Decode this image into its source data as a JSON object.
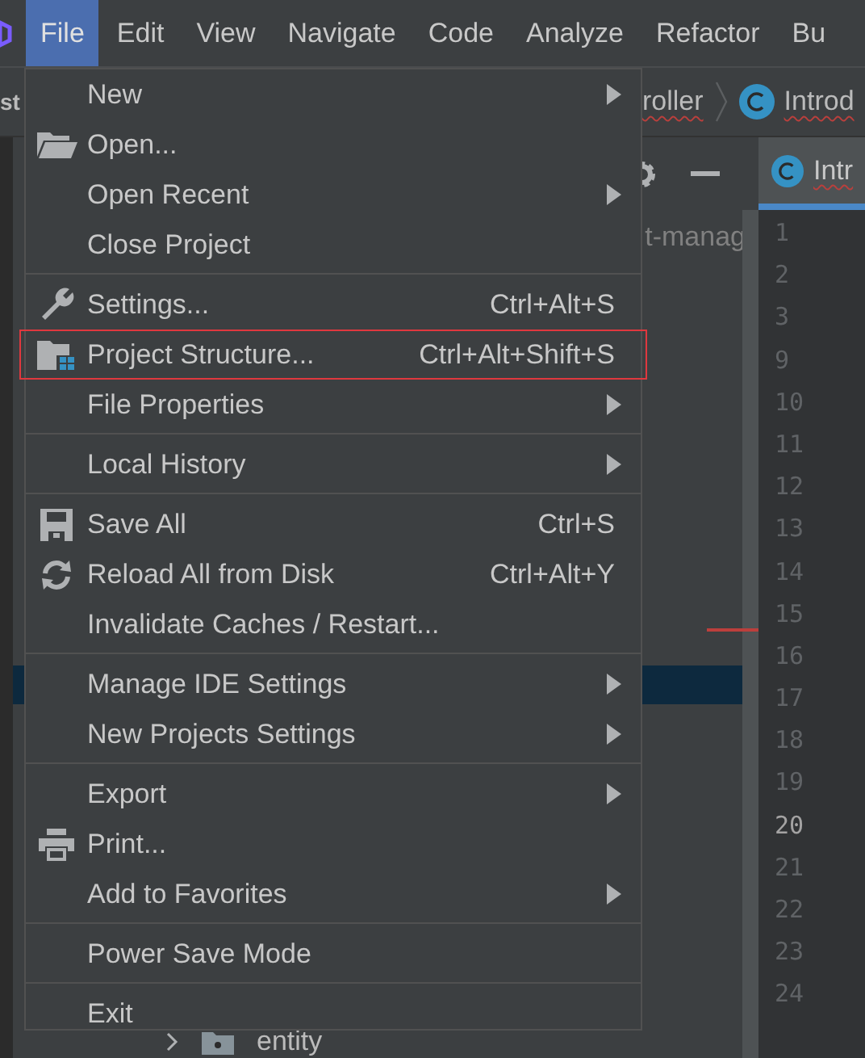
{
  "menu_bar": [
    {
      "label": "File",
      "selected": true
    },
    {
      "label": "Edit",
      "selected": false
    },
    {
      "label": "View",
      "selected": false
    },
    {
      "label": "Navigate",
      "selected": false
    },
    {
      "label": "Code",
      "selected": false
    },
    {
      "label": "Analyze",
      "selected": false
    },
    {
      "label": "Refactor",
      "selected": false
    },
    {
      "label": "Bu",
      "selected": false
    }
  ],
  "file_menu": {
    "groups": [
      [
        {
          "label": "New",
          "submenu": true,
          "highlighted": false
        },
        {
          "label": "Open...",
          "submenu": false,
          "highlighted": false
        },
        {
          "label": "Open Recent",
          "submenu": true,
          "highlighted": false
        },
        {
          "label": "Close Project",
          "submenu": false,
          "highlighted": false
        }
      ],
      [
        {
          "label": "Settings...",
          "shortcut": "Ctrl+Alt+S",
          "submenu": false,
          "highlighted": false
        },
        {
          "label": "Project Structure...",
          "shortcut": "Ctrl+Alt+Shift+S",
          "submenu": false,
          "highlighted": true
        },
        {
          "label": "File Properties",
          "submenu": true,
          "highlighted": false
        }
      ],
      [
        {
          "label": "Local History",
          "submenu": true,
          "highlighted": false
        }
      ],
      [
        {
          "label": "Save All",
          "shortcut": "Ctrl+S",
          "submenu": false,
          "highlighted": false
        },
        {
          "label": "Reload All from Disk",
          "shortcut": "Ctrl+Alt+Y",
          "submenu": false,
          "highlighted": false
        },
        {
          "label": "Invalidate Caches / Restart...",
          "submenu": false,
          "highlighted": false
        }
      ],
      [
        {
          "label": "Manage IDE Settings",
          "submenu": true,
          "highlighted": false
        },
        {
          "label": "New Projects Settings",
          "submenu": true,
          "highlighted": false
        }
      ],
      [
        {
          "label": "Export",
          "submenu": true,
          "highlighted": false
        },
        {
          "label": "Print...",
          "submenu": false,
          "highlighted": false
        },
        {
          "label": "Add to Favorites",
          "submenu": true,
          "highlighted": false
        }
      ],
      [
        {
          "label": "Power Save Mode",
          "submenu": false,
          "highlighted": false
        }
      ],
      [
        {
          "label": "Exit",
          "submenu": false,
          "highlighted": false
        }
      ]
    ]
  },
  "background": {
    "project_label": "st",
    "breadcrumb": [
      "roller",
      "Introd"
    ],
    "editor_tab": "Intr",
    "tree_text": "t-manag",
    "tree_folder": "entity",
    "line_numbers": [
      {
        "number": "1",
        "current": false
      },
      {
        "number": "2",
        "current": false
      },
      {
        "number": "3",
        "current": false
      },
      {
        "number": "9",
        "current": false
      },
      {
        "number": "10",
        "current": false
      },
      {
        "number": "11",
        "current": false
      },
      {
        "number": "12",
        "current": false
      },
      {
        "number": "13",
        "current": false
      },
      {
        "number": "14",
        "current": false
      },
      {
        "number": "15",
        "current": false
      },
      {
        "number": "16",
        "current": false
      },
      {
        "number": "17",
        "current": false
      },
      {
        "number": "18",
        "current": false
      },
      {
        "number": "19",
        "current": false
      },
      {
        "number": "20",
        "current": true
      },
      {
        "number": "21",
        "current": false
      },
      {
        "number": "22",
        "current": false
      },
      {
        "number": "23",
        "current": false
      },
      {
        "number": "24",
        "current": false
      }
    ]
  }
}
